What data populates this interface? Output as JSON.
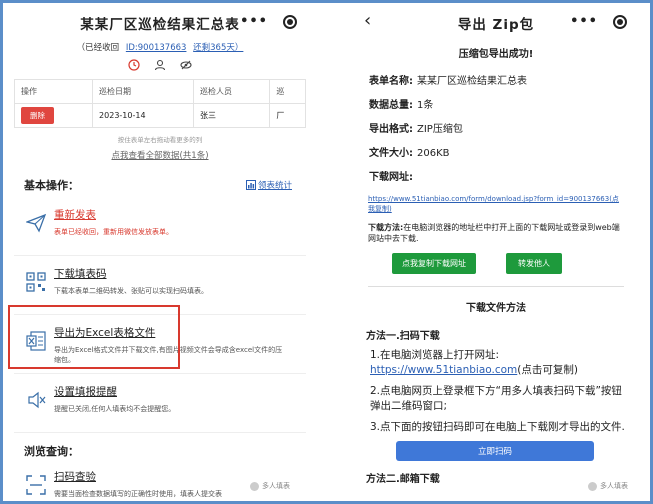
{
  "left": {
    "title": "某某厂区巡检结果汇总表",
    "more_label": "•••",
    "status": "（已经收回",
    "id_text": "ID:900137663",
    "days": "还剩365天）",
    "table": {
      "headers": [
        "操作",
        "巡检日期",
        "巡检人员",
        "巡"
      ],
      "row": {
        "delete": "删除",
        "date": "2023-10-14",
        "person": "张三",
        "extra": "厂"
      }
    },
    "hint": "按住表单左右拖动看更多的列",
    "view_all": "点我查看全部数据(共1条)",
    "section_basic": "基本操作：",
    "stats_link": "领表统计",
    "ops": [
      {
        "title": "重新发表",
        "desc": "表单已经收回，重新用微信发放表单。"
      },
      {
        "title": "下载填表码",
        "desc": "下载本表单二维码转发、张贴可以实现扫码填表。"
      },
      {
        "title": "导出为Excel表格文件",
        "desc": "导出为Excel格式文件并下载文件,有图片视频文件会导成含excel文件的压缩包。"
      },
      {
        "title": "设置填报提醒",
        "desc": "提醒已关闭,任何人填表均不会提醒您。"
      }
    ],
    "section_browse": "浏览查询：",
    "scan_title": "扫码查验",
    "scan_desc": "需要当面检查数据填写的正确性时使用，填表人提交表",
    "watermark": "多人填表"
  },
  "right": {
    "title": "导出 Zip包",
    "more_label": "•••",
    "success": "压缩包导出成功!",
    "fields": [
      {
        "label": "表单名称:",
        "value": "某某厂区巡检结果汇总表"
      },
      {
        "label": "数据总量:",
        "value": "1条"
      },
      {
        "label": "导出格式:",
        "value": "ZIP压缩包"
      },
      {
        "label": "文件大小:",
        "value": "206KB"
      }
    ],
    "download_label": "下载网址:",
    "download_url": "https://www.51tianbiao.com/form/download.jsp?form_id=900137663(点我复制)",
    "method_label": "下载方法:",
    "method_text": "在电脑浏览器的地址栏中打开上面的下载网址或登录到web端网站中去下载.",
    "copy_btn": "点我复制下载网址",
    "forward_btn": "转发他人",
    "methods_title": "下载文件方法",
    "method1": "方法一.扫码下载",
    "step1": "1.在电脑浏览器上打开网址:",
    "step1_url": "https://www.51tianbiao.com",
    "step1_copy": "(点击可复制)",
    "step2": "2.点电脑网页上登录框下方“用多人填表扫码下载”按钮弹出二维码窗口;",
    "step3": "3.点下面的按钮扫码即可在电脑上下载刚才导出的文件.",
    "scan_btn": "立即扫码",
    "method2": "方法二.邮箱下载",
    "watermark": "多人填表"
  }
}
